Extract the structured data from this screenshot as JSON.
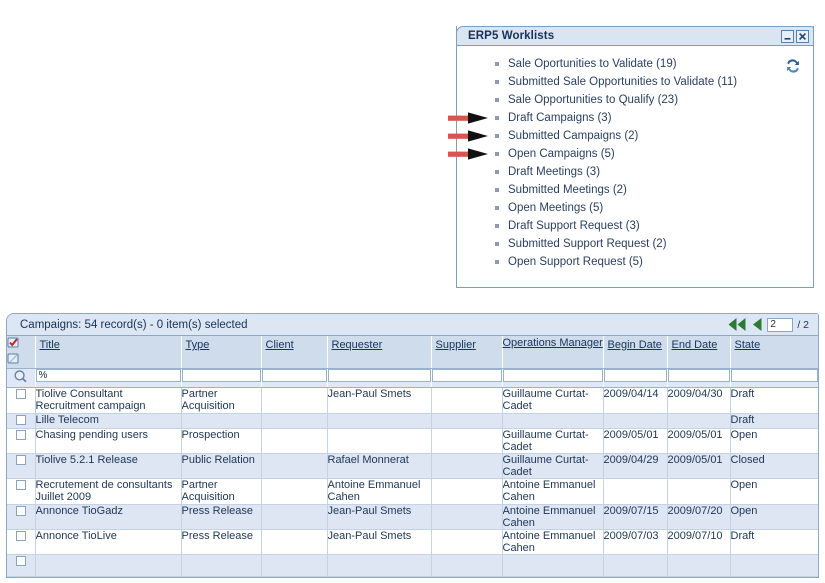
{
  "worklist_panel": {
    "title": "ERP5 Worklists",
    "window_buttons": [
      {
        "name": "minimize-button",
        "glyph": "minimize"
      },
      {
        "name": "close-button",
        "glyph": "close"
      }
    ],
    "refresh_icon": "refresh-icon",
    "items": [
      {
        "label": "Sale Oportunities to Validate (19)",
        "marked": false
      },
      {
        "label": "Submitted Sale Opportunities to Validate (11)",
        "marked": false
      },
      {
        "label": "Sale Opportunities to Qualify (23)",
        "marked": false
      },
      {
        "label": "Draft Campaigns (3)",
        "marked": true
      },
      {
        "label": "Submitted Campaigns (2)",
        "marked": true
      },
      {
        "label": "Open Campaigns (5)",
        "marked": true
      },
      {
        "label": "Draft Meetings (3)",
        "marked": false
      },
      {
        "label": "Submitted Meetings (2)",
        "marked": false
      },
      {
        "label": "Open Meetings (5)",
        "marked": false
      },
      {
        "label": "Draft Support Request (3)",
        "marked": false
      },
      {
        "label": "Submitted Support Request (2)",
        "marked": false
      },
      {
        "label": "Open Support Request (5)",
        "marked": false
      }
    ]
  },
  "listbox": {
    "title": "Campaigns: 54 record(s) - 0 item(s) selected",
    "pagination": {
      "first_page_icon": "first-page-icon",
      "previous_page_icon": "previous-page-icon",
      "page_value": "2",
      "page_total": "/ 2"
    },
    "select_all_icon": "select-all-icon",
    "deselect_all_icon": "deselect-all-icon",
    "search_icon": "search-icon",
    "columns": [
      "Title",
      "Type",
      "Client",
      "Requester",
      "Supplier",
      "Operations Manager",
      "Begin Date",
      "End Date",
      "State"
    ],
    "filters": {
      "title": "%",
      "type": "",
      "client": "",
      "requester": "",
      "supplier": "",
      "operations_manager": "",
      "begin_date": "",
      "end_date": "",
      "state": ""
    },
    "rows": [
      {
        "title": "Tiolive Consultant Recruitment campaign",
        "type": "Partner Acquisition",
        "client": "",
        "requester": "Jean-Paul Smets",
        "supplier": "",
        "operations_manager": "Guillaume Curtat-Cadet",
        "begin_date": "2009/04/14",
        "end_date": "2009/04/30",
        "state": "Draft"
      },
      {
        "title": "Lille Telecom",
        "type": "",
        "client": "",
        "requester": "",
        "supplier": "",
        "operations_manager": "",
        "begin_date": "",
        "end_date": "",
        "state": "Draft"
      },
      {
        "title": "Chasing pending users",
        "type": "Prospection",
        "client": "",
        "requester": "",
        "supplier": "",
        "operations_manager": "Guillaume Curtat-Cadet",
        "begin_date": "2009/05/01",
        "end_date": "2009/05/01",
        "state": "Open"
      },
      {
        "title": "Tiolive 5.2.1 Release",
        "type": "Public Relation",
        "client": "",
        "requester": "Rafael Monnerat",
        "supplier": "",
        "operations_manager": "Guillaume Curtat-Cadet",
        "begin_date": "2009/04/29",
        "end_date": "2009/05/01",
        "state": "Closed"
      },
      {
        "title": "Recrutement de consultants Juillet 2009",
        "type": "Partner Acquisition",
        "client": "",
        "requester": "Antoine Emmanuel Cahen",
        "supplier": "",
        "operations_manager": "Antoine Emmanuel Cahen",
        "begin_date": "",
        "end_date": "",
        "state": "Open"
      },
      {
        "title": "Annonce TioGadz",
        "type": "Press Release",
        "client": "",
        "requester": "Jean-Paul Smets",
        "supplier": "",
        "operations_manager": "Antoine Emmanuel Cahen",
        "begin_date": "2009/07/15",
        "end_date": "2009/07/20",
        "state": "Open"
      },
      {
        "title": "Annonce TioLive",
        "type": "Press Release",
        "client": "",
        "requester": "Jean-Paul Smets",
        "supplier": "",
        "operations_manager": "Antoine Emmanuel Cahen",
        "begin_date": "2009/07/03",
        "end_date": "2009/07/10",
        "state": "Draft"
      },
      {
        "title": "",
        "type": "",
        "client": "",
        "requester": "",
        "supplier": "",
        "operations_manager": "",
        "begin_date": "",
        "end_date": "",
        "state": ""
      }
    ]
  },
  "colors": {
    "panel_header": "#dbe5f1",
    "panel_border": "#7b9ec4",
    "table_header": "#cfdceb",
    "row_stripe": "#dde6f2",
    "text": "#1a3560",
    "annotation_arrow": "#d9534f",
    "pager_arrow": "#2d7a34"
  }
}
